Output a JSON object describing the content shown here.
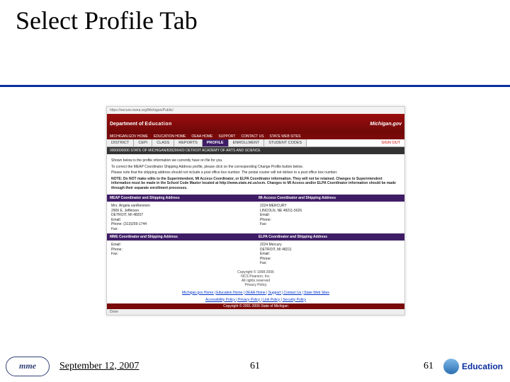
{
  "title": "Select Profile Tab",
  "topbar": "https://secure.nwea.org/Michigan/Public/",
  "banner": {
    "dept": "Department of",
    "edu": "Education",
    "gov": "Michigan.gov"
  },
  "subnav": [
    "MICHIGAN.GOV HOME",
    "EDUCATION HOME",
    "OEAA HOME",
    "SUPPORT",
    "CONTACT US",
    "STATE WEB SITES"
  ],
  "tabs": [
    {
      "label": "DISTRICT",
      "active": false
    },
    {
      "label": "CEPI",
      "active": false
    },
    {
      "label": "CLASS",
      "active": false
    },
    {
      "label": "REPORTS",
      "active": false
    },
    {
      "label": "PROFILE",
      "active": true
    },
    {
      "label": "ENROLLMENT",
      "active": false
    },
    {
      "label": "STUDENT CODES",
      "active": false
    }
  ],
  "signout": "SIGN OUT",
  "schoolbar": "0000000000 STATE OF MICHIGAN/828290420 DETROIT ACADEMY OF ARTS AND SCIENCE",
  "body": {
    "line1": "Shown below is the profile information we currently have on file for you.",
    "line2": "To correct the MEAP Coordinator Shipping Address profile, please click on the corresponding Change Profile button below.",
    "line3": "Please note that the shipping address should not include a post office box number. The postal courier will not deliver to a post office box number.",
    "note": "NOTE: Do NOT make edits to the Superintendent, MI Access Coordinator, or ELPA Coordinator information. They will not be retained. Changes to Superintendent information must be made in the School Code Master located at http://www.state.mi.us/scm. Changes to MI Access and/or ELPA Coordinator information should be made through their separate enrollment processes."
  },
  "hdr1": {
    "l": "MEAP Coordinator and Shipping Address",
    "r": "MI-Access Coordinator and Shipping Address"
  },
  "row1": {
    "l": "Mrs. Angela vanRenmen\n2906 E. Jefferson\nDETROIT, MI 48207\nEmail:\nPhone: (313)259-1744\nFax:",
    "r": "2224 MERCURY\nLINCOLN, NE 48211-5026\nEmail:\nPhone:\nFax:"
  },
  "hdr2": {
    "l": "MME Coordinator and Shipping Address",
    "r": "ELPA Coordinator and Shipping Address"
  },
  "row2": {
    "l": "Email:\nPhone:\nFax:",
    "r": "2224 Mercury\nDETROIT, MI 48211\nEmail:\nPhone:\nFax:"
  },
  "ftr": "Copyright © 1998-2006\nNCS Pearson, Inc.\nAll rights reserved\nPrivacy Policy",
  "links1": "Michigan.gov Home | Education Home | OEAA Home | Support | Contact Us | State Web Sites",
  "links2": "Accessibility Policy | Privacy Policy | Link Policy | Security Policy",
  "copy": "Copyright © 2001-2006 State of Michigan",
  "footer": {
    "date": "September 12, 2007",
    "page_center": "61",
    "page_right": "61",
    "mme": "mme",
    "edu": "Education"
  }
}
